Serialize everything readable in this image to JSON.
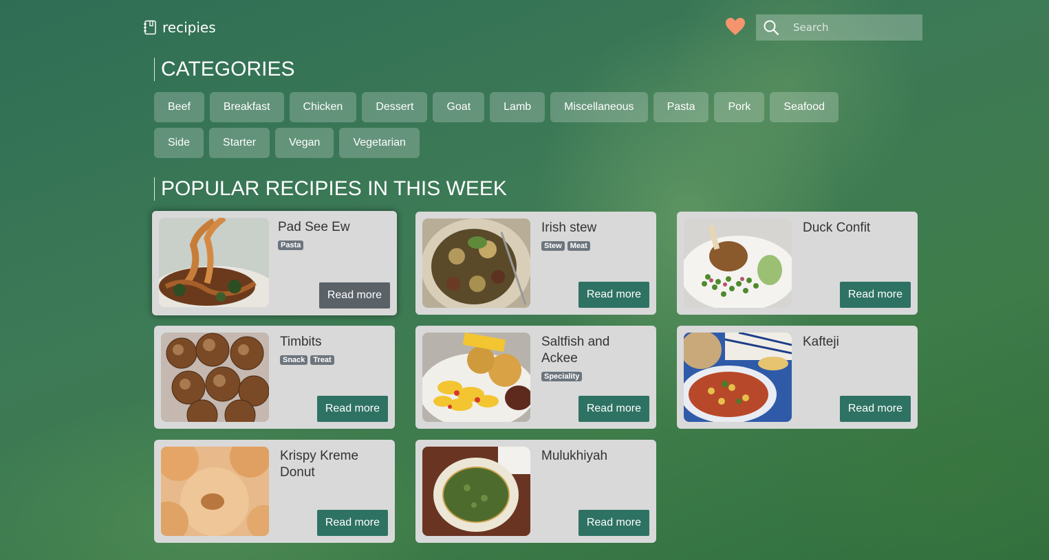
{
  "header": {
    "logo_text": "recipies",
    "search_placeholder": "Search"
  },
  "categories": {
    "title": "CATEGORIES",
    "items": [
      "Beef",
      "Breakfast",
      "Chicken",
      "Dessert",
      "Goat",
      "Lamb",
      "Miscellaneous",
      "Pasta",
      "Pork",
      "Seafood",
      "Side",
      "Starter",
      "Vegan",
      "Vegetarian"
    ]
  },
  "popular": {
    "title": "POPULAR RECIPIES IN THIS WEEK",
    "read_more_label": "Read more",
    "recipes": [
      {
        "name": "Pad See Ew",
        "tags": [
          "Pasta"
        ],
        "image": "noodles-photo"
      },
      {
        "name": "Irish stew",
        "tags": [
          "Stew",
          "Meat"
        ],
        "image": "stew-photo"
      },
      {
        "name": "Duck Confit",
        "tags": [],
        "image": "duck-photo"
      },
      {
        "name": "Timbits",
        "tags": [
          "Snack",
          "Treat"
        ],
        "image": "timbits-photo"
      },
      {
        "name": "Saltfish and Ackee",
        "tags": [
          "Speciality"
        ],
        "image": "saltfish-photo"
      },
      {
        "name": "Kafteji",
        "tags": [],
        "image": "kafteji-photo"
      },
      {
        "name": "Krispy Kreme Donut",
        "tags": [],
        "image": "donut-photo"
      },
      {
        "name": "Mulukhiyah",
        "tags": [],
        "image": "mulukhiyah-photo"
      }
    ]
  },
  "colors": {
    "accent": "#2e7263",
    "heart": "#f4956e",
    "card_bg": "#d9d9d9"
  }
}
